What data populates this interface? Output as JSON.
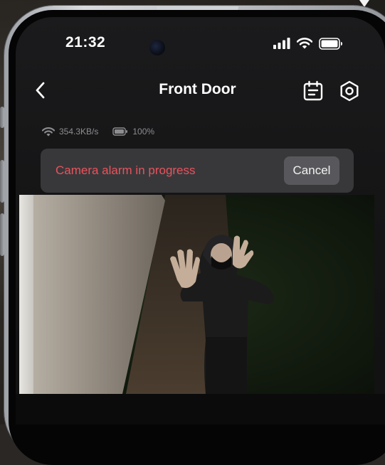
{
  "status_bar": {
    "time": "21:32"
  },
  "nav": {
    "title": "Front Door",
    "back_icon": "chevron-left-icon",
    "calendar_icon": "calendar-list-icon",
    "settings_icon": "gear-hexagon-icon"
  },
  "connection": {
    "speed": "354.3KB/s",
    "battery": "100%"
  },
  "alarm": {
    "message": "Camera alarm in progress",
    "cancel_label": "Cancel"
  },
  "colors": {
    "alarm_text": "#e9535c",
    "banner_bg": "#38383b",
    "cancel_bg": "#58585c"
  }
}
